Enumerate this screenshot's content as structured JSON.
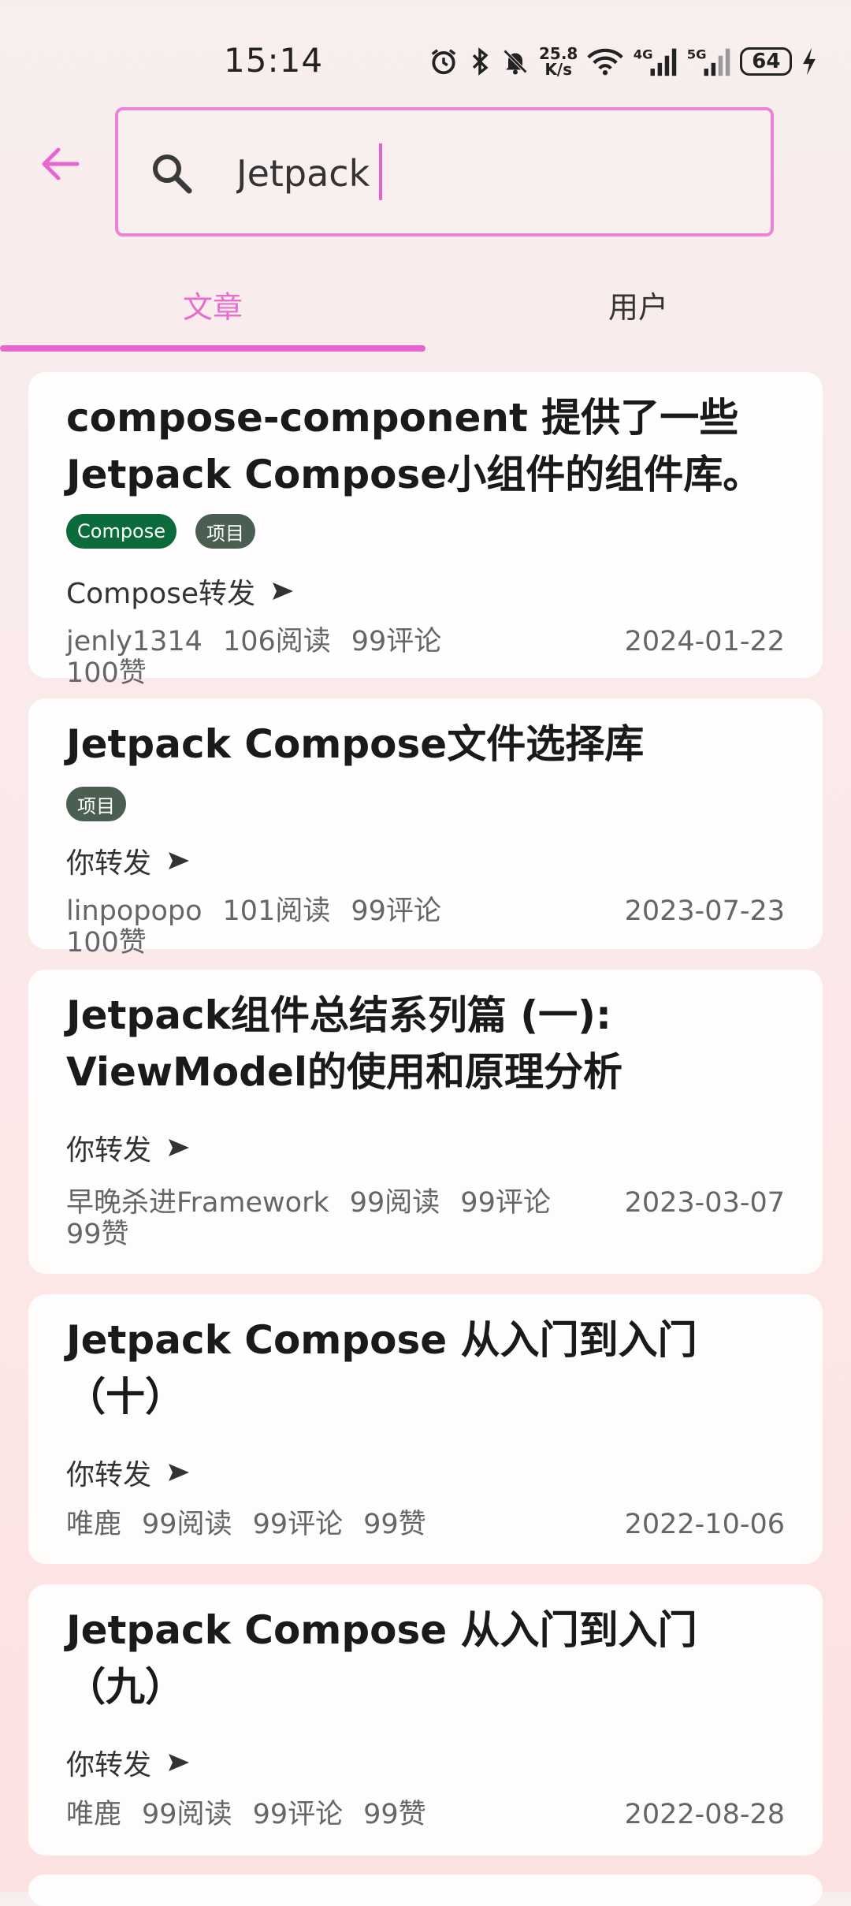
{
  "status": {
    "time": "15:14",
    "net_speed_value": "25.8",
    "net_speed_unit": "K/s",
    "signal1_label": "4G",
    "signal2_label": "5G",
    "battery": "64"
  },
  "search": {
    "value": "Jetpack"
  },
  "tabs": [
    {
      "label": "文章",
      "active": true
    },
    {
      "label": "用户",
      "active": false
    }
  ],
  "accent_color": "#e866cf",
  "articles": [
    {
      "title": "compose-component 提供了一些 Jetpack Compose小组件的组件库。",
      "tags": [
        "Compose",
        "项目"
      ],
      "share": "Compose转发",
      "author": "jenly1314",
      "reads": "106阅读",
      "comments": "99评论",
      "likes": "100赞",
      "date": "2024-01-22"
    },
    {
      "title": "Jetpack Compose文件选择库",
      "tags": [
        "项目"
      ],
      "share": "你转发",
      "author": "linpopopo",
      "reads": "101阅读",
      "comments": "99评论",
      "likes": "100赞",
      "date": "2023-07-23"
    },
    {
      "title": "Jetpack组件总结系列篇 (一): ViewModel的使用和原理分析",
      "tags": [],
      "share": "你转发",
      "author": "早晚杀进Framework",
      "reads": "99阅读",
      "comments": "99评论",
      "likes": "99赞",
      "date": "2023-03-07"
    },
    {
      "title": "Jetpack Compose 从入门到入门（十）",
      "tags": [],
      "share": "你转发",
      "author": "唯鹿",
      "reads": "99阅读",
      "comments": "99评论",
      "likes": "99赞",
      "date": "2022-10-06"
    },
    {
      "title": "Jetpack Compose 从入门到入门（九）",
      "tags": [],
      "share": "你转发",
      "author": "唯鹿",
      "reads": "99阅读",
      "comments": "99评论",
      "likes": "99赞",
      "date": "2022-08-28"
    }
  ]
}
